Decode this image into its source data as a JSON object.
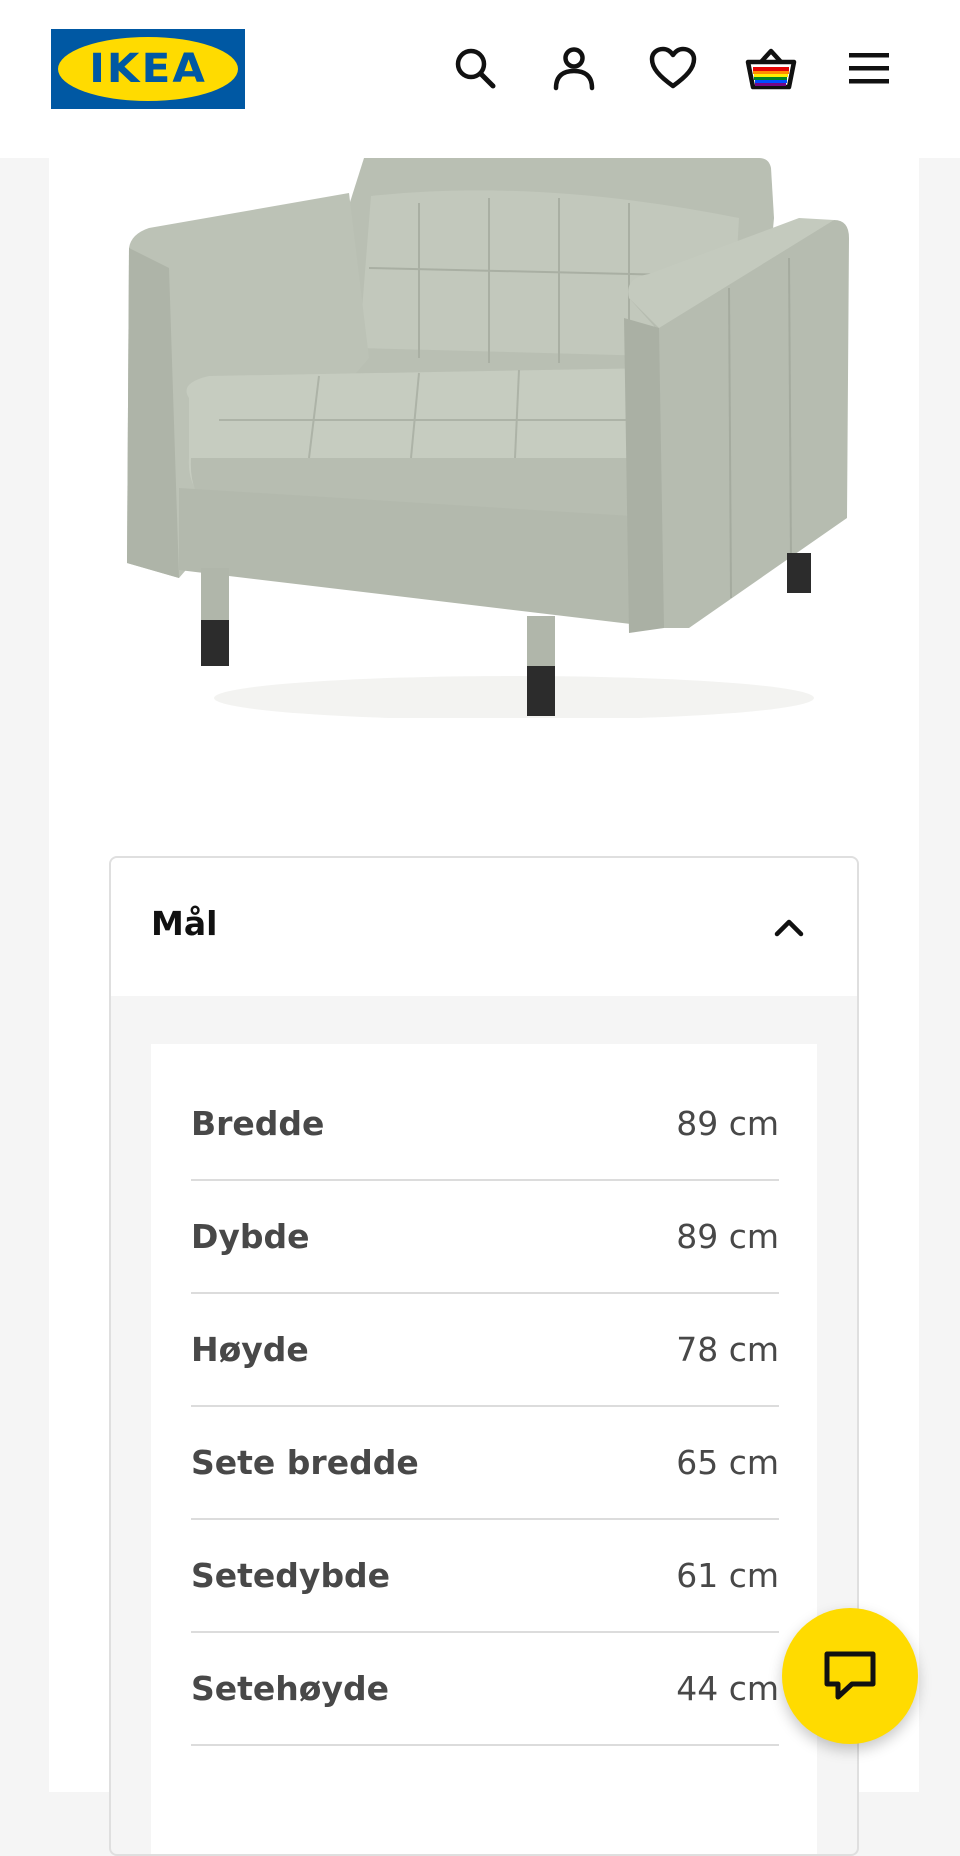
{
  "header": {
    "logo_text": "IKEA",
    "icons": [
      "search-icon",
      "account-icon",
      "heart-icon",
      "basket-icon",
      "menu-icon"
    ]
  },
  "colors": {
    "ikea_blue": "#0058a3",
    "ikea_yellow": "#ffdb00",
    "text_grey": "#484848"
  },
  "product": {
    "image": "armchair-light-green-fabric"
  },
  "dimensions": {
    "title": "Mål",
    "expanded": true,
    "rows": [
      {
        "label": "Bredde",
        "value": "89 cm"
      },
      {
        "label": "Dybde",
        "value": "89 cm"
      },
      {
        "label": "Høyde",
        "value": "78 cm"
      },
      {
        "label": "Sete bredde",
        "value": "65 cm"
      },
      {
        "label": "Setedybde",
        "value": "61 cm"
      },
      {
        "label": "Setehøyde",
        "value": "44 cm"
      }
    ]
  },
  "chat": {
    "icon": "chat-bubble-icon"
  }
}
